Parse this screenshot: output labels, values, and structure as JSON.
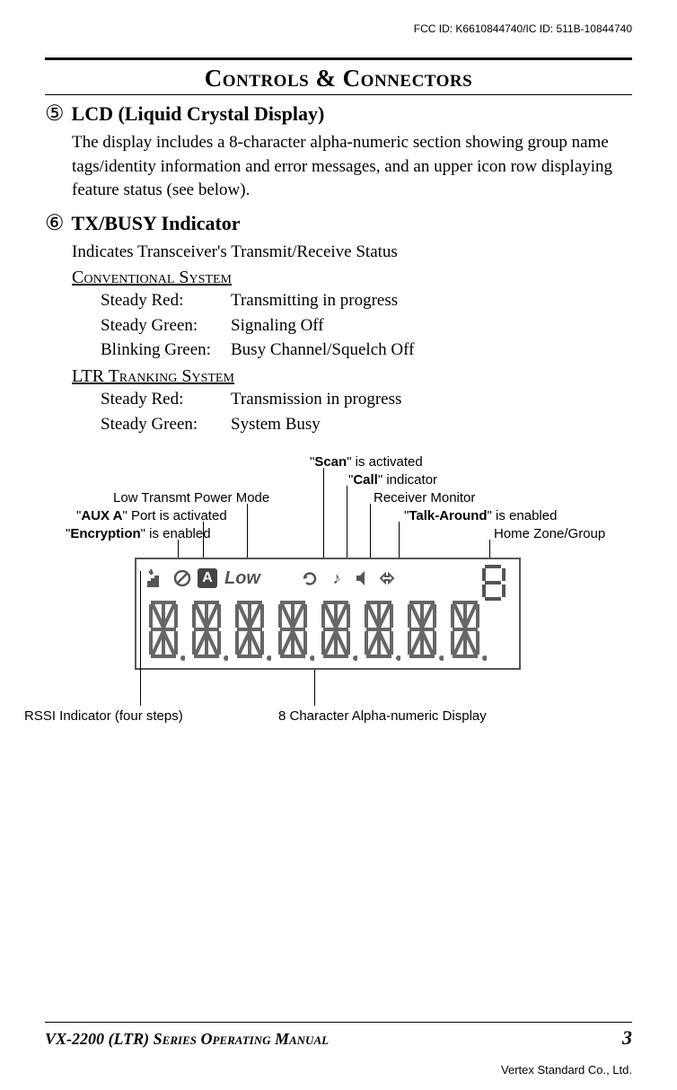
{
  "header": {
    "fcc_id": "FCC ID: K6610844740/IC ID: 511B-10844740",
    "title": "Controls & Connectors"
  },
  "sections": [
    {
      "number": "⑤",
      "heading": "LCD (Liquid Crystal Display)",
      "body": "The display includes a 8-character alpha-numeric section showing group name tags/identity information and error messages, and an upper icon row displaying feature status (see below)."
    },
    {
      "number": "⑥",
      "heading": "TX/BUSY Indicator",
      "body": "Indicates Transceiver's Transmit/Receive Status",
      "systems": [
        {
          "name": "Conventional System",
          "rows": [
            {
              "label": "Steady Red:",
              "value": "Transmitting in progress"
            },
            {
              "label": "Steady Green:",
              "value": "Signaling Off"
            },
            {
              "label": "Blinking Green:",
              "value": "Busy Channel/Squelch Off"
            }
          ]
        },
        {
          "name": "LTR Tranking System",
          "rows": [
            {
              "label": "Steady Red:",
              "value": "Transmission in progress"
            },
            {
              "label": "Steady Green:",
              "value": "System Busy"
            }
          ]
        }
      ]
    }
  ],
  "lcd": {
    "low_text": "Low",
    "aux_a": "A",
    "callouts": {
      "scan": {
        "bold": "Scan",
        "pre": "\"",
        "post": "\" is activated"
      },
      "call": {
        "bold": "Call",
        "pre": "\"",
        "post": "\" indicator"
      },
      "low_power": "Low Transmt Power Mode",
      "receiver": "Receiver Monitor",
      "aux": {
        "bold": "AUX A",
        "pre": "\"",
        "post": "\" Port is activated"
      },
      "talk": {
        "bold": "Talk-Around",
        "pre": "\"",
        "post": "\" is enabled"
      },
      "encryption": {
        "bold": "Encryption",
        "pre": "\"",
        "post": "\" is enabled"
      },
      "home": "Home Zone/Group",
      "rssi": "RSSI Indicator (four steps)",
      "eight_char": "8 Character Alpha-numeric Display"
    }
  },
  "footer": {
    "manual": "VX-2200 (LTR) Series Operating Manual",
    "page": "3",
    "company": "Vertex Standard Co., Ltd."
  }
}
